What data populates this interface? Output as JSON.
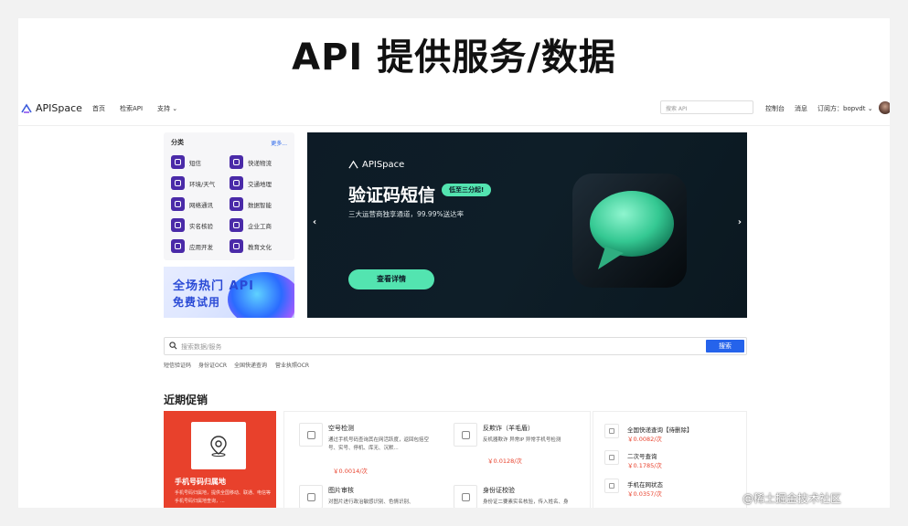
{
  "slide_title": "API 提供服务/数据",
  "nav": {
    "logo": "APISpace",
    "links": [
      "首页",
      "检索API",
      "支持 ⌄"
    ],
    "search_placeholder": "搜索 API",
    "right_links": [
      "控制台",
      "消息",
      "订阅方：bopvdt ⌄"
    ]
  },
  "categories": {
    "header": "分类",
    "more": "更多...",
    "items": [
      "短信",
      "快递物流",
      "环境/天气",
      "交通地理",
      "网络通讯",
      "数据智能",
      "实名核验",
      "企业工商",
      "应用开发",
      "教育文化"
    ]
  },
  "promo_banner": {
    "line1": "全场热门 API",
    "line2": "免费试用"
  },
  "hero": {
    "logo": "APISpace",
    "title": "验证码短信",
    "badge": "低至三分起!",
    "subtitle": "三大运营商独享通道，99.99%送达率",
    "button": "查看详情",
    "prev": "‹",
    "next": "›"
  },
  "main_search": {
    "placeholder": "搜索数据/服务",
    "button": "搜索"
  },
  "quick_links": [
    "短信验证码",
    "身份证OCR",
    "全国快递查询",
    "营业执照OCR"
  ],
  "section_title": "近期促销",
  "featured": {
    "title": "手机号码归属地",
    "desc": "手机号码归属地，提供全国移动、联通、电信等手机号码归属地查询，..."
  },
  "promo_items": [
    {
      "title": "空号检测",
      "desc": "通过手机号码查询其在网活跃度，返回包括空号、实号、停机、库无、沉默...",
      "price": "￥0.0014/次"
    },
    {
      "title": "反欺诈（羊毛盾）",
      "desc": "反机器欺诈 异常IP 异常手机号检测",
      "price": "￥0.0128/次"
    },
    {
      "title": "图片审核",
      "desc": "对图片进行政治敏感识别、色情识别、",
      "price": ""
    },
    {
      "title": "身份证校验",
      "desc": "身份证二要素实名核验，传入姓名、身",
      "price": ""
    }
  ],
  "right_items": [
    {
      "title": "全国快递查询【待删除】",
      "price": "￥0.0082/次"
    },
    {
      "title": "二次号查询",
      "price": "￥0.1785/次"
    },
    {
      "title": "手机在网状态",
      "price": "￥0.0357/次"
    }
  ],
  "watermark": "@稀土掘金技术社区",
  "colors": {
    "accent": "#2563eb",
    "promo_red": "#e8412c",
    "hero_green": "#53e4b0",
    "category_purple": "#4a2aa8"
  }
}
